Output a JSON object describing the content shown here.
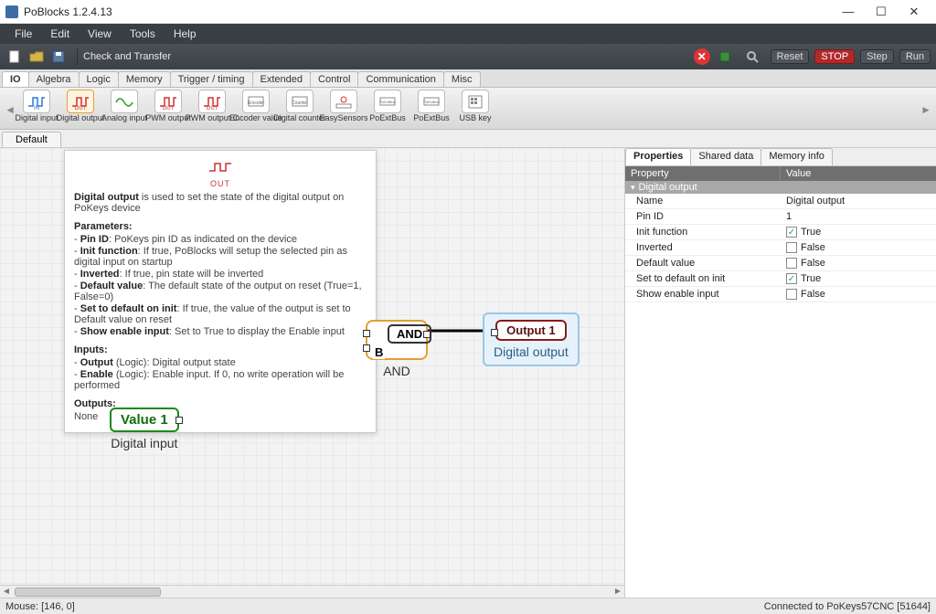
{
  "window": {
    "title": "PoBlocks 1.2.4.13",
    "minimize": "—",
    "maximize": "☐",
    "close": "✕"
  },
  "menu": {
    "file": "File",
    "edit": "Edit",
    "view": "View",
    "tools": "Tools",
    "help": "Help"
  },
  "toolbar": {
    "check_transfer": "Check and Transfer",
    "reset": "Reset",
    "stop": "STOP",
    "step": "Step",
    "run": "Run"
  },
  "cattabs": {
    "io": "IO",
    "algebra": "Algebra",
    "logic": "Logic",
    "memory": "Memory",
    "trigger": "Trigger / timing",
    "extended": "Extended",
    "control": "Control",
    "comm": "Communication",
    "misc": "Misc"
  },
  "palette": {
    "left_arrow": "◄",
    "right_arrow": "►",
    "items": [
      {
        "label": "Digital input",
        "icon": "in-blue"
      },
      {
        "label": "Digital output",
        "icon": "out-red",
        "selected": true
      },
      {
        "label": "Analog input",
        "icon": "wave-green"
      },
      {
        "label": "PWM output",
        "icon": "out-red"
      },
      {
        "label": "PWM output C",
        "icon": "out-red"
      },
      {
        "label": "Encoder value",
        "icon": "encoder"
      },
      {
        "label": "Digital counter",
        "icon": "counter"
      },
      {
        "label": "EasySensors",
        "icon": "sensor"
      },
      {
        "label": "PoExtBus",
        "icon": "bus"
      },
      {
        "label": "PoExtBus",
        "icon": "bus"
      },
      {
        "label": "USB key",
        "icon": "keypad"
      }
    ]
  },
  "tabs2": {
    "default": "Default"
  },
  "help": {
    "icon_caption": "OUT",
    "title_bold": "Digital output",
    "title_rest": " is used to set the state of the digital output on PoKeys device",
    "params_h": "Parameters:",
    "params": [
      {
        "k": "Pin ID",
        "v": ": PoKeys pin ID as indicated on the device"
      },
      {
        "k": "Init function",
        "v": ": If true, PoBlocks will setup the selected pin as digital input on startup"
      },
      {
        "k": "Inverted",
        "v": ": If true, pin state will be inverted"
      },
      {
        "k": "Default value",
        "v": ": The default state of the output on reset (True=1, False=0)"
      },
      {
        "k": "Set to default on init",
        "v": ": If true, the value of the output is set to Default value on reset"
      },
      {
        "k": "Show enable input",
        "v": ": Set to True to display the Enable input"
      }
    ],
    "inputs_h": "Inputs:",
    "inputs": [
      {
        "k": "Output",
        "v": " (Logic): Digital output state"
      },
      {
        "k": "Enable",
        "v": " (Logic): Enable input. If 0, no write operation will be performed"
      }
    ],
    "outputs_h": "Outputs:",
    "outputs_none": "None"
  },
  "graph": {
    "value_label": "Value 1",
    "value_caption": "Digital input",
    "and_label": "AND",
    "and_B": "B",
    "and_caption": "AND",
    "output_label": "Output 1",
    "output_caption": "Digital output"
  },
  "props": {
    "tab_props": "Properties",
    "tab_shared": "Shared data",
    "tab_mem": "Memory info",
    "col_prop": "Property",
    "col_val": "Value",
    "group": "Digital output",
    "rows": [
      {
        "name": "Name",
        "value": "Digital output",
        "type": "text"
      },
      {
        "name": "Pin ID",
        "value": "1",
        "type": "text"
      },
      {
        "name": "Init function",
        "value": "True",
        "type": "check",
        "checked": true
      },
      {
        "name": "Inverted",
        "value": "False",
        "type": "check",
        "checked": false
      },
      {
        "name": "Default value",
        "value": "False",
        "type": "check",
        "checked": false
      },
      {
        "name": "Set to default on init",
        "value": "True",
        "type": "check",
        "checked": true
      },
      {
        "name": "Show enable input",
        "value": "False",
        "type": "check",
        "checked": false
      }
    ]
  },
  "status": {
    "mouse": "Mouse: [146, 0]",
    "conn": "Connected to PoKeys57CNC [51644]"
  }
}
